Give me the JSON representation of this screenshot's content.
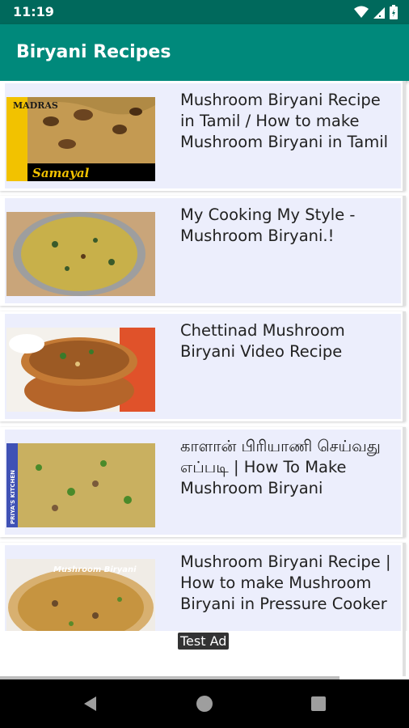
{
  "status": {
    "time": "11:19"
  },
  "app": {
    "title": "Biryani Recipes"
  },
  "items": [
    {
      "title": "Mushroom Biryani Recipe in Tamil / How to make Mushroom Biryani in Tamil",
      "thumb_text_1": "MADRAS",
      "thumb_text_2": "Samayal"
    },
    {
      "title": "My Cooking My Style -Mushroom Biryani.!"
    },
    {
      "title": "Chettinad Mushroom Biryani Video Recipe"
    },
    {
      "title": "காளான் பிரியாணி செய்வது எப்படி | How To Make Mushroom Biryani",
      "thumb_text_1": "PRIYA'S KITCHEN"
    },
    {
      "title": "Mushroom Biryani Recipe | How to make Mushroom Biryani in Pressure Cooker",
      "thumb_text_1": "Mushroom Biryani"
    }
  ],
  "ad": {
    "label": "Test Ad"
  },
  "colors": {
    "status_bar": "#00695c",
    "app_bar": "#00897b",
    "card_bg": "#eceefc"
  },
  "icons": [
    "wifi-icon",
    "signal-icon",
    "battery-icon",
    "back-icon",
    "home-icon",
    "recents-icon"
  ]
}
